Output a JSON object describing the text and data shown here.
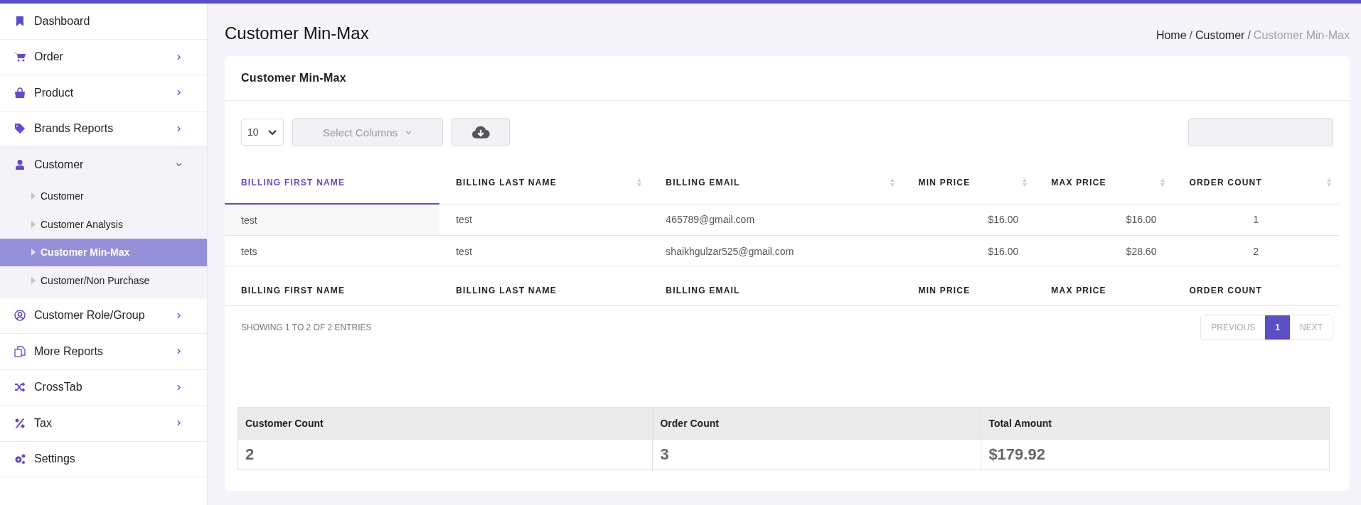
{
  "sidebar": {
    "items": [
      {
        "label": "Dashboard"
      },
      {
        "label": "Order",
        "expanded": false
      },
      {
        "label": "Product",
        "expanded": false
      },
      {
        "label": "Brands Reports",
        "expanded": false
      },
      {
        "label": "Customer",
        "expanded": true,
        "children": [
          {
            "label": "Customer",
            "selected": false
          },
          {
            "label": "Customer Analysis",
            "selected": false
          },
          {
            "label": "Customer Min-Max",
            "selected": true
          },
          {
            "label": "Customer/Non Purchase",
            "selected": false
          }
        ]
      },
      {
        "label": "Customer Role/Group",
        "expanded": false
      },
      {
        "label": "More Reports",
        "expanded": false
      },
      {
        "label": "CrossTab",
        "expanded": false
      },
      {
        "label": "Tax",
        "expanded": false
      },
      {
        "label": "Settings"
      }
    ]
  },
  "page_title": "Customer Min-Max",
  "breadcrumb_separator": "/",
  "breadcrumb": [
    {
      "label": "Home",
      "current": false
    },
    {
      "label": "Customer",
      "current": false
    },
    {
      "label": "Customer Min-Max",
      "current": true
    }
  ],
  "card": {
    "title": "Customer Min-Max",
    "page_length": "10",
    "select_columns": {
      "placeholder": "Select Columns"
    },
    "table": {
      "columns": [
        {
          "label": "BILLING FIRST NAME",
          "sorted": true
        },
        {
          "label": "BILLING LAST NAME",
          "sorted": false
        },
        {
          "label": "BILLING EMAIL",
          "sorted": false
        },
        {
          "label": "MIN PRICE",
          "sorted": false
        },
        {
          "label": "MAX PRICE",
          "sorted": false
        },
        {
          "label": "ORDER COUNT",
          "sorted": false
        }
      ],
      "rows": [
        [
          "test",
          "test",
          "465789@gmail.com",
          "$16.00",
          "$16.00",
          "1"
        ],
        [
          "tets",
          "test",
          "shaikhgulzar525@gmail.com",
          "$16.00",
          "$28.60",
          "2"
        ]
      ],
      "footer": [
        "BILLING FIRST NAME",
        "BILLING LAST NAME",
        "BILLING EMAIL",
        "MIN PRICE",
        "MAX PRICE",
        "ORDER COUNT"
      ]
    },
    "info": "SHOWING 1 TO 2 OF 2 ENTRIES",
    "pagination": [
      {
        "label": "PREVIOUS",
        "selected": false
      },
      {
        "label": "1",
        "selected": true
      },
      {
        "label": "NEXT",
        "selected": false
      }
    ],
    "summary": {
      "columns": [
        "Customer Count",
        "Order Count",
        "Total Amount"
      ],
      "values": [
        "2",
        "3",
        "$179.92"
      ]
    }
  }
}
